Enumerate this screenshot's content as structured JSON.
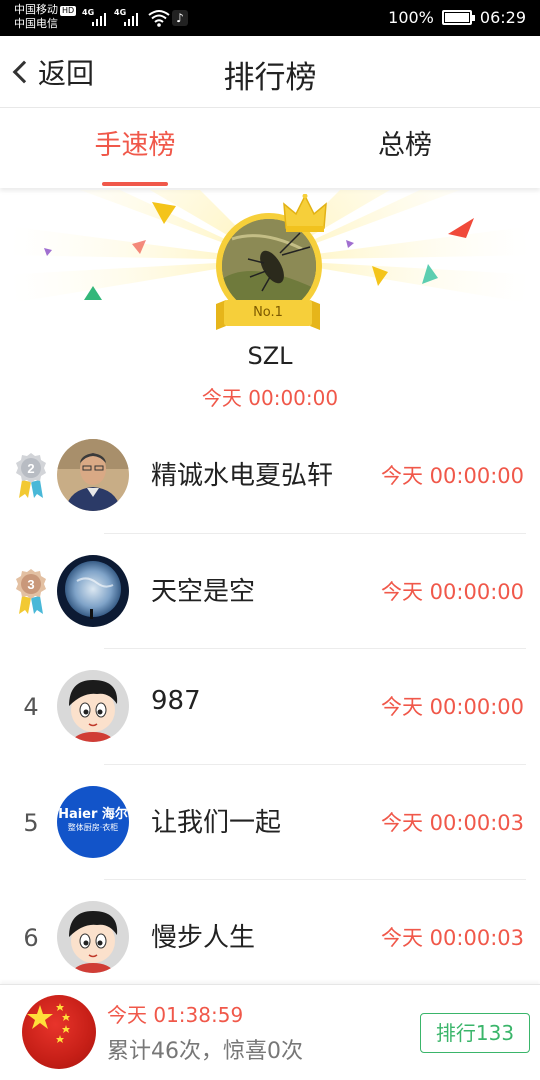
{
  "status_bar": {
    "carrier1": "中国移动",
    "carrier1_badge": "HD",
    "carrier2": "中国电信",
    "signal1_tag": "4G",
    "signal2_tag": "4G",
    "battery_text": "100%",
    "clock": "06:29",
    "icons": [
      "signal-icon",
      "wifi-icon",
      "tiktok-icon",
      "battery-icon"
    ]
  },
  "header": {
    "back_label": "返回",
    "title": "排行榜"
  },
  "tabs": [
    {
      "label": "手速榜",
      "active": true
    },
    {
      "label": "总榜",
      "active": false
    }
  ],
  "champion": {
    "badge": "No.1",
    "name": "SZL",
    "time": "今天 00:00:00"
  },
  "ranking": [
    {
      "rank": "2",
      "medal": "silver",
      "name": "精诚水电夏弘轩",
      "time": "今天 00:00:00",
      "avatar": "man-photo"
    },
    {
      "rank": "3",
      "medal": "bronze",
      "name": "天空是空",
      "time": "今天 00:00:00",
      "avatar": "earth-photo"
    },
    {
      "rank": "4",
      "medal": "",
      "name": "987",
      "time": "今天 00:00:00",
      "avatar": "cartoon-boy"
    },
    {
      "rank": "5",
      "medal": "",
      "name": "让我们一起",
      "time": "今天 00:00:03",
      "avatar": "haier-logo"
    },
    {
      "rank": "6",
      "medal": "",
      "name": "慢步人生",
      "time": "今天 00:00:03",
      "avatar": "cartoon-boy"
    }
  ],
  "haier_logo": {
    "line1": "Haier 海尔",
    "line2": "整体厨房·衣柜"
  },
  "me": {
    "time": "今天 01:38:59",
    "stats": "累计46次，惊喜0次",
    "rank_button": "排行133"
  },
  "colors": {
    "accent": "#f0584a",
    "gold": "#f6cf3a",
    "green": "#3ab56a"
  }
}
